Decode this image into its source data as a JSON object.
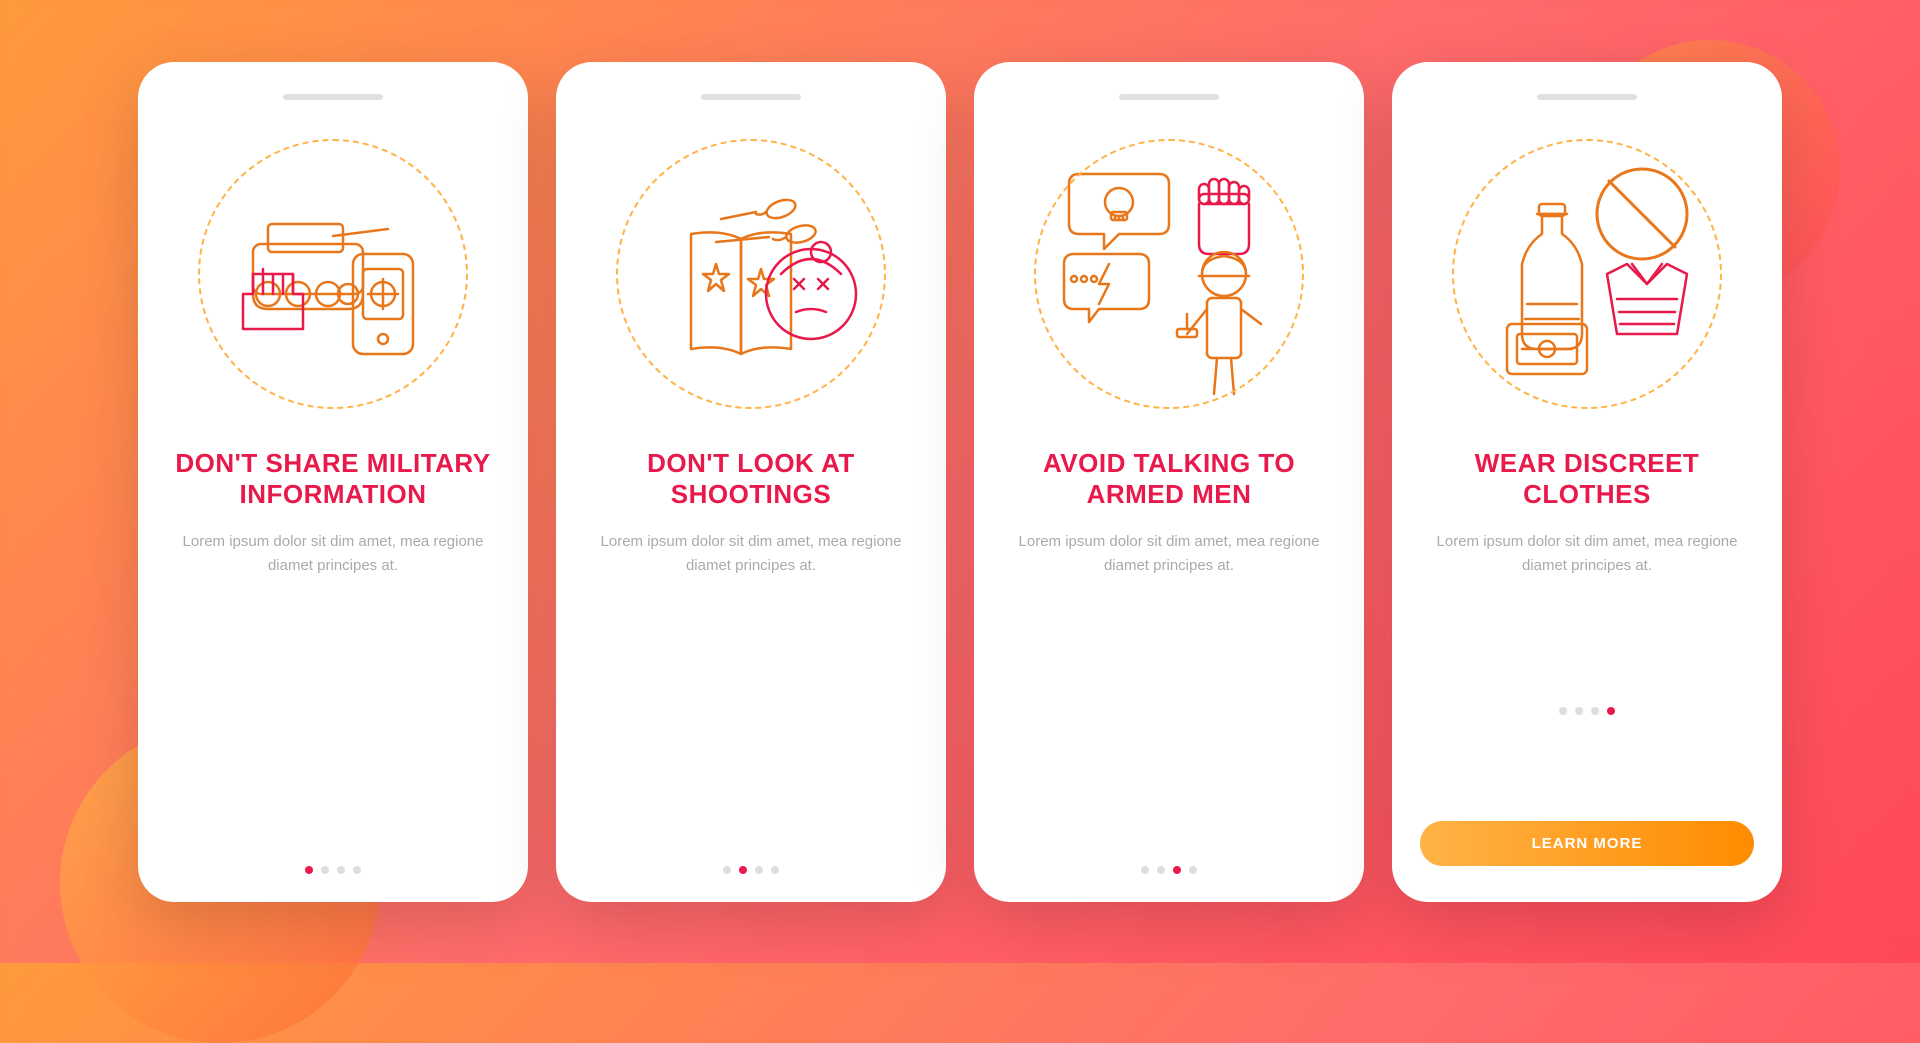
{
  "background": {
    "gradient_start": "#ff9a3c",
    "gradient_end": "#ff4757"
  },
  "cards": [
    {
      "id": "card-1",
      "notch": true,
      "title": "DON'T SHARE MILITARY INFORMATION",
      "body": "Lorem ipsum dolor sit dim amet, mea regione diamet principes at.",
      "dots": [
        true,
        false,
        false,
        false
      ],
      "has_button": false,
      "icon": "military-info-icon"
    },
    {
      "id": "card-2",
      "notch": true,
      "title": "DON'T LOOK AT SHOOTINGS",
      "body": "Lorem ipsum dolor sit dim amet, mea regione diamet principes at.",
      "dots": [
        false,
        true,
        false,
        false
      ],
      "has_button": false,
      "icon": "shootings-icon"
    },
    {
      "id": "card-3",
      "notch": true,
      "title": "AVOID TALKING TO ARMED MEN",
      "body": "Lorem ipsum dolor sit dim amet, mea regione diamet principes at.",
      "dots": [
        false,
        false,
        true,
        false
      ],
      "has_button": false,
      "icon": "armed-men-icon"
    },
    {
      "id": "card-4",
      "notch": true,
      "title": "WEAR DISCREET CLOTHES",
      "body": "Lorem ipsum dolor sit dim amet, mea regione diamet principes at.",
      "dots": [
        false,
        false,
        false,
        true
      ],
      "has_button": true,
      "button_label": "LEARN MORE",
      "icon": "discreet-clothes-icon"
    }
  ]
}
